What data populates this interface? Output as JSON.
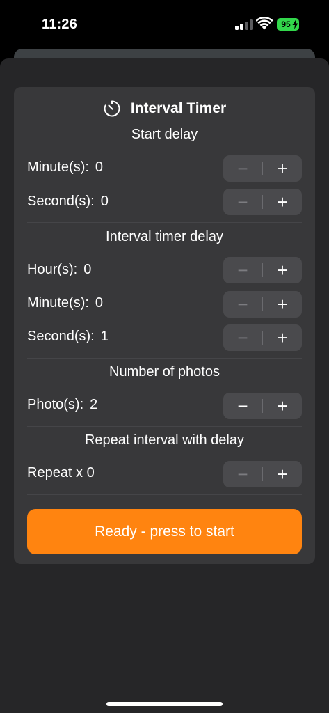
{
  "status_bar": {
    "time": "11:26",
    "battery_level": "95",
    "battery_color": "#32d74b"
  },
  "colors": {
    "sheet_background": "#262628",
    "card_background": "#38383a",
    "stepper_background": "#4a4a4d",
    "accent_button": "#ff8410"
  },
  "icons": {
    "stepper_minus": "−",
    "stepper_plus": "+"
  },
  "header": {
    "title": "Interval Timer",
    "icon": "timer-icon"
  },
  "sections": {
    "start_delay": {
      "heading": "Start delay",
      "minutes": {
        "label": "Minute(s):",
        "value": "0",
        "minus_enabled": false
      },
      "seconds": {
        "label": "Second(s):",
        "value": "0",
        "minus_enabled": false
      }
    },
    "interval_delay": {
      "heading": "Interval timer delay",
      "hours": {
        "label": "Hour(s):",
        "value": "0",
        "minus_enabled": false
      },
      "minutes": {
        "label": "Minute(s):",
        "value": "0",
        "minus_enabled": false
      },
      "seconds": {
        "label": "Second(s):",
        "value": "1",
        "minus_enabled": false
      }
    },
    "photos": {
      "heading": "Number of photos",
      "count": {
        "label": "Photo(s):",
        "value": "2",
        "minus_enabled": true
      }
    },
    "repeat": {
      "heading": "Repeat interval with delay",
      "count": {
        "label": "Repeat x 0",
        "minus_enabled": false
      }
    }
  },
  "start_button": {
    "label": "Ready - press to start"
  }
}
